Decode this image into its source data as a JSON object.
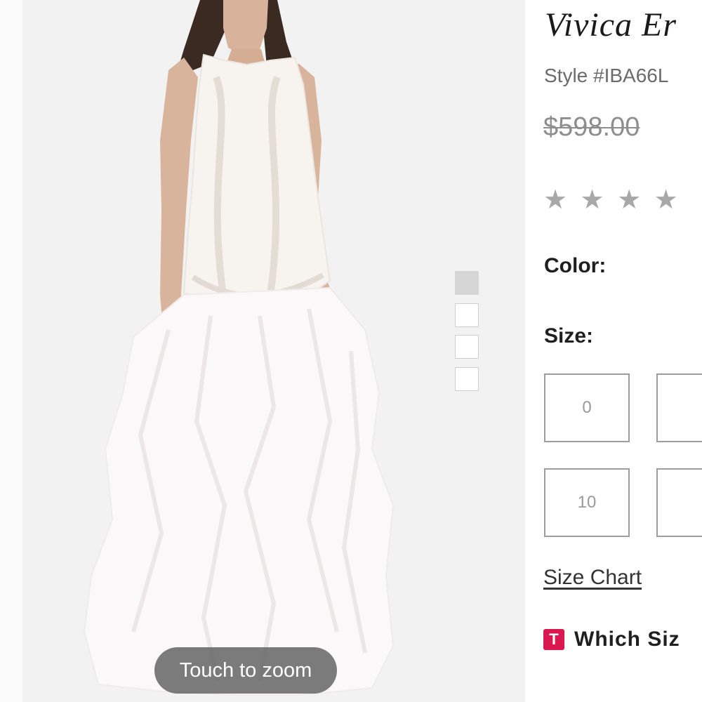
{
  "product": {
    "title": "Vivica Er",
    "style_number": "Style #IBA66L",
    "price": "$598.00",
    "rating": {
      "filled": 0,
      "visible_stars": 4,
      "star_glyph": "★"
    },
    "color_label": "Color:",
    "size_label": "Size:",
    "sizes": [
      "0",
      "",
      "10",
      ""
    ],
    "size_chart_label": "Size Chart",
    "which_size": {
      "badge": "T",
      "label": "Which Siz",
      "badge_color": "#d9184f"
    }
  },
  "gallery": {
    "zoom_hint": "Touch to zoom",
    "thumbnails": [
      {
        "active": true
      },
      {
        "active": false
      },
      {
        "active": false
      },
      {
        "active": false
      }
    ]
  },
  "colors": {
    "accent": "#d9184f",
    "panel_bg": "#f3f2f2",
    "muted_text": "#8e8e8e"
  }
}
